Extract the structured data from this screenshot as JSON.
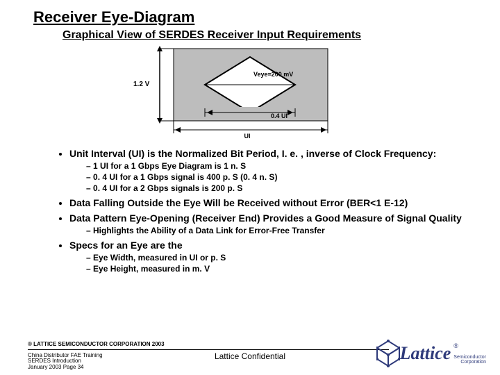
{
  "title": "Receiver Eye-Diagram",
  "subtitle": "Graphical View of SERDES Receiver Input Requirements",
  "figure": {
    "y_label": "1.2 V",
    "veye_label": "Veye=200 mV",
    "x_inner_label": "0.4 UI",
    "x_full_label": "UI"
  },
  "bullets": [
    {
      "text": "Unit Interval (UI) is the Normalized Bit Period, I. e. , inverse of Clock Frequency:",
      "sub": [
        "1 UI for a 1 Gbps Eye Diagram is 1 n. S",
        "0. 4 UI for a 1 Gbps signal is 400 p. S (0. 4 n. S)",
        "0. 4 UI for a 2 Gbps signals is 200 p. S"
      ]
    },
    {
      "text": "Data Falling Outside the Eye Will be Received without Error (BER<1 E-12)"
    },
    {
      "text": "Data Pattern Eye-Opening (Receiver End) Provides a Good Measure of Signal Quality",
      "sub": [
        "Highlights the Ability of a Data Link for Error-Free Transfer"
      ]
    },
    {
      "text": "Specs for an Eye are the",
      "sub": [
        "Eye Width, measured in UI or p. S",
        "Eye Height, measured in m. V"
      ]
    }
  ],
  "footer": {
    "copyright": "® LATTICE SEMICONDUCTOR CORPORATION 2003",
    "left1": "China Distributor FAE Training",
    "left2": "SERDES Introduction",
    "left3": "January 2003  Page 34",
    "center": "Lattice Confidential",
    "logo": "Lattice",
    "logo_sub1": "Semiconductor",
    "logo_sub2": "Corporation",
    "reg": "®"
  }
}
